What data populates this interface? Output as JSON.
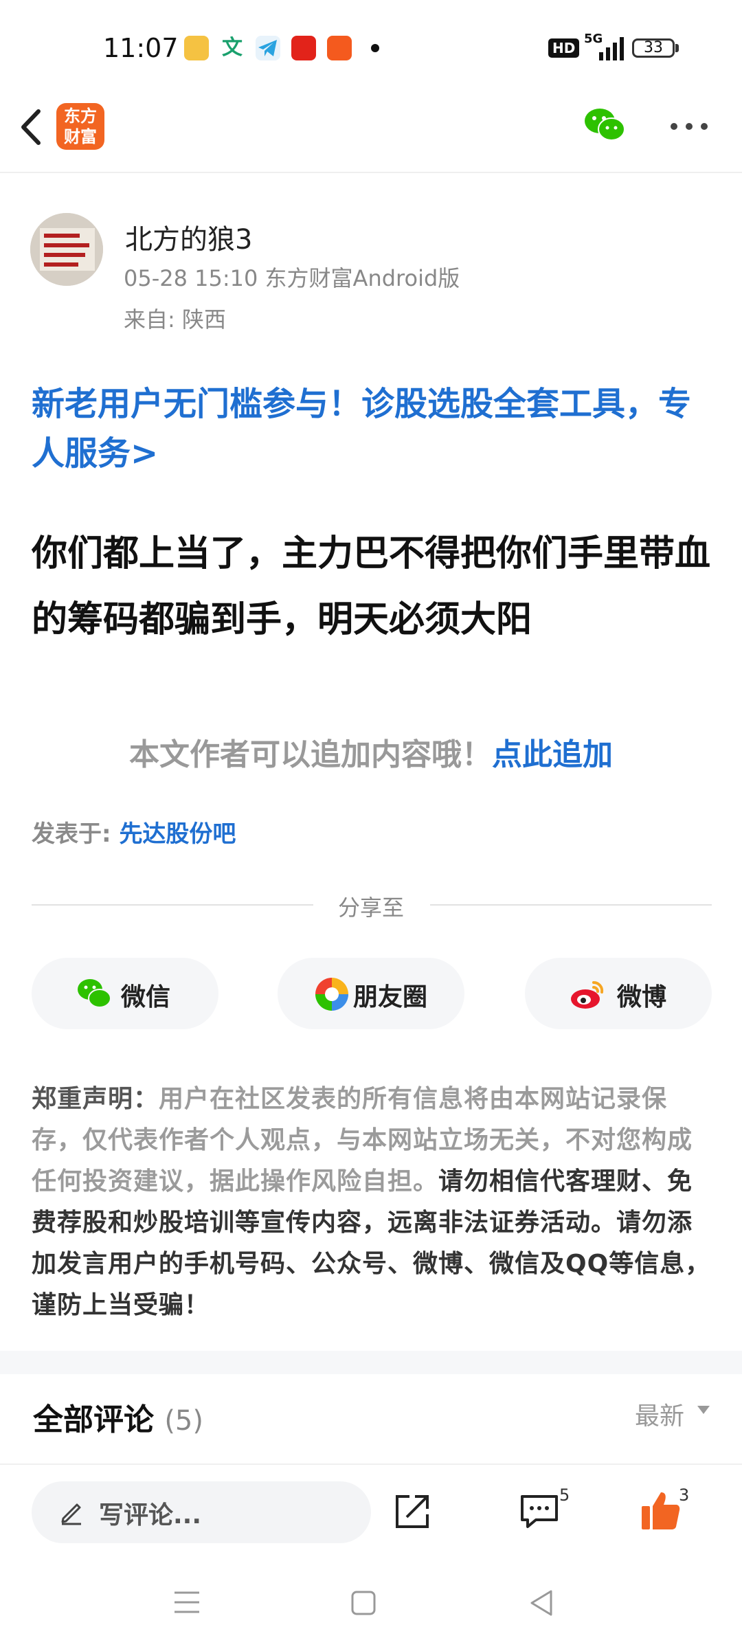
{
  "status_bar": {
    "time": "11:07",
    "network": "5G",
    "hd_badge": "HD",
    "battery": "33",
    "app_icons": [
      "weibo-orange-icon",
      "translate-icon",
      "telegram-icon",
      "red-app-icon",
      "orange-app-icon"
    ]
  },
  "nav": {
    "logo_line1": "东方",
    "logo_line2": "财富",
    "brand_color": "#f26522"
  },
  "post": {
    "author": "北方的狼3",
    "meta": "05-28 15:10 东方财富Android版",
    "location": "来自: 陕西",
    "promo": "新老用户无门槛参与！诊股选股全套工具，专人服务>",
    "content": "你们都上当了，主力巴不得把你们手里带血的筹码都骗到手，明天必须大阳",
    "append_hint": "本文作者可以追加内容哦！",
    "append_link": "点此追加",
    "posted_in_label": "发表于: ",
    "posted_in_bar": "先达股份吧"
  },
  "share": {
    "label": "分享至",
    "buttons": [
      {
        "label": "微信",
        "icon": "wechat-icon"
      },
      {
        "label": "朋友圈",
        "icon": "moments-icon"
      },
      {
        "label": "微博",
        "icon": "weibo-icon"
      }
    ]
  },
  "notice": {
    "title": "郑重声明：",
    "part1": "用户在社区发表的所有信息将由本网站记录保存，仅代表作者个人观点，与本网站立场无关，不对您构成任何投资建议，据此操作风险自担。",
    "part2": "请勿相信代客理财、免费荐股和炒股培训等宣传内容，远离非法证券活动。请勿添加发言用户的手机号码、公众号、微博、微信及QQ等信息，谨防上当受骗！"
  },
  "comments": {
    "title": "全部评论",
    "count": "(5)",
    "sort": "最新"
  },
  "bottom_bar": {
    "write_placeholder": "写评论...",
    "comment_count": "5",
    "like_count": "3",
    "accent": "#f26522"
  }
}
